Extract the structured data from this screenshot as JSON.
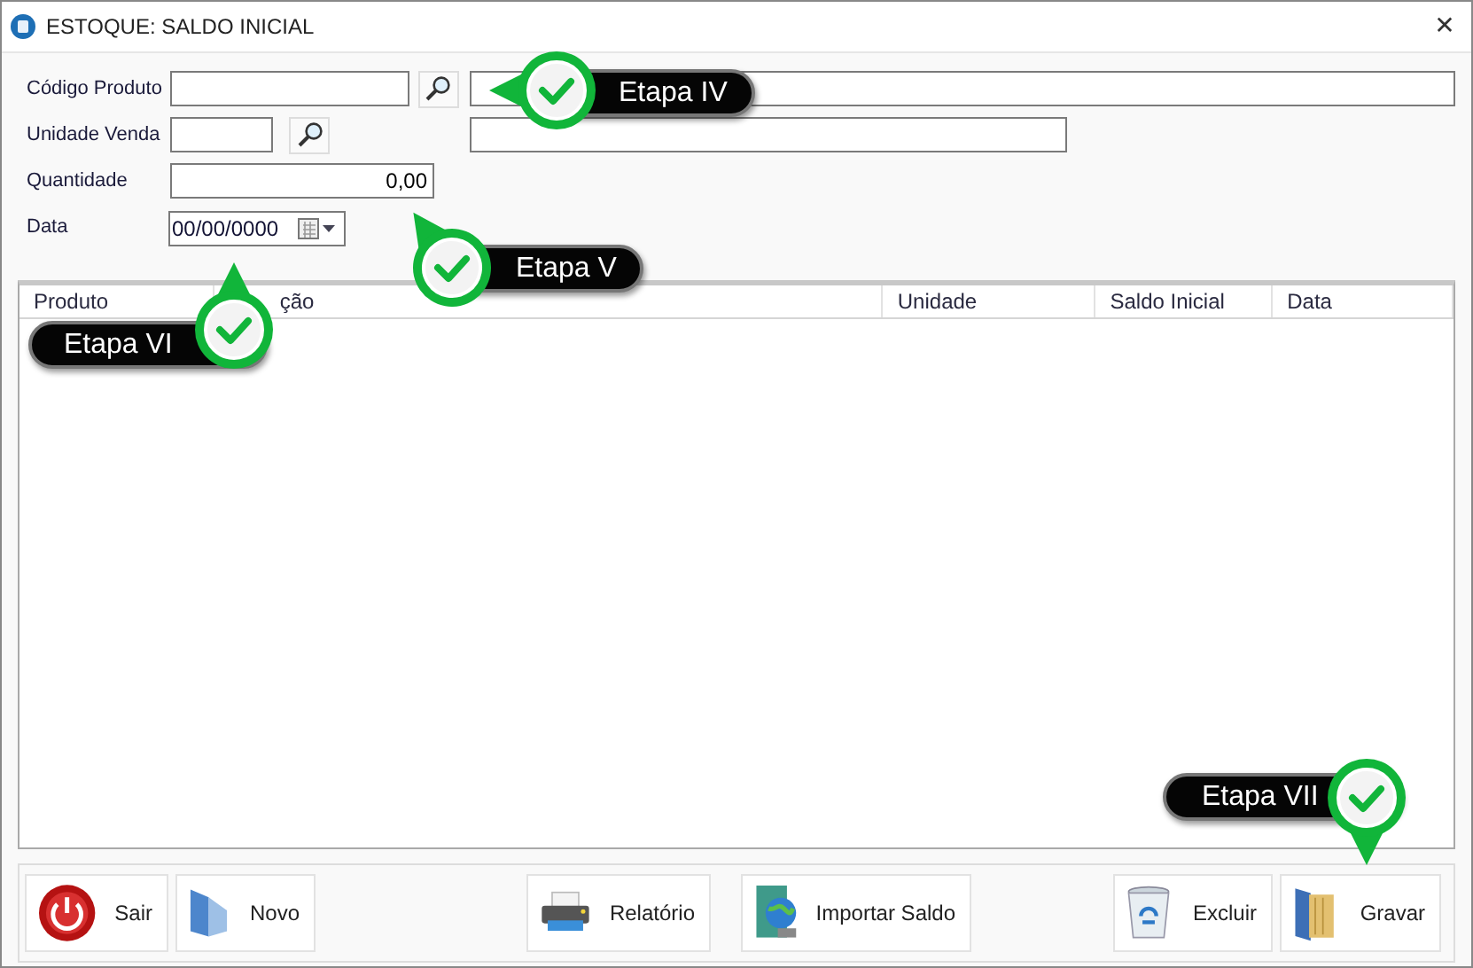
{
  "window": {
    "title": "ESTOQUE: SALDO INICIAL",
    "close": "✕"
  },
  "form": [
    {
      "label": "Código Produto",
      "kind": "lookup"
    },
    {
      "label": "Unidade Venda",
      "kind": "lookup"
    },
    {
      "label": "Quantidade",
      "kind": "number",
      "value": "0,00"
    },
    {
      "label": "Data",
      "kind": "date",
      "value": "00/00/0000"
    }
  ],
  "table": {
    "columns": [
      "Produto",
      "ção",
      "Unidade",
      "Saldo Inicial",
      "Data"
    ]
  },
  "buttons": [
    {
      "label": "Sair",
      "kind": "exit"
    },
    {
      "label": "Novo",
      "kind": "new"
    },
    {
      "label": "Relatório",
      "kind": "report"
    },
    {
      "label": "Importar Saldo",
      "kind": "import"
    },
    {
      "label": "Excluir",
      "kind": "delete"
    },
    {
      "label": "Gravar",
      "kind": "save"
    }
  ],
  "callouts": [
    {
      "text": "Etapa IV"
    },
    {
      "text": "Etapa V"
    },
    {
      "text": "Etapa VI"
    },
    {
      "text": "Etapa VII"
    }
  ]
}
